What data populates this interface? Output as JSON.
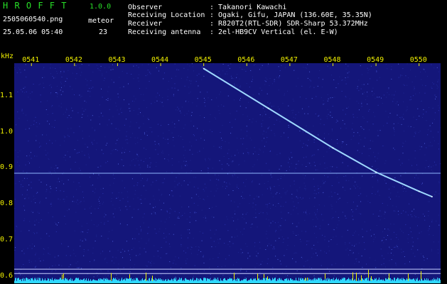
{
  "app": {
    "name": "H R O F F T",
    "version": "1.0.0",
    "filename": "2505060540.png",
    "datetime": "25.05.06 05:40",
    "meteor_label": "meteor",
    "meteor_count": "23"
  },
  "info": {
    "rows": [
      {
        "label": "Observer",
        "value": ": Takanori Kawachi"
      },
      {
        "label": "Receiving Location",
        "value": ": Ogaki, Gifu, JAPAN (136.60E, 35.35N)"
      },
      {
        "label": "Receiver",
        "value": ": R820T2(RTL-SDR) SDR-Sharp 53.372MHz"
      },
      {
        "label": "Receiving antenna",
        "value": ": 2el-HB9CV Vertical (el. E-W)"
      }
    ]
  },
  "colors": {
    "background": "#000000",
    "plot_bg": "#14167a",
    "label_yellow": "#f0f000",
    "title_green": "#28e028",
    "trace": "#9fd8ff",
    "baseline": "#30d8ff"
  },
  "chart_data": {
    "type": "scatter",
    "xlabel": "",
    "ylabel": "kHz",
    "x_ticks": [
      "0541",
      "0542",
      "0543",
      "0544",
      "0545",
      "0546",
      "0547",
      "0548",
      "0549",
      "0550"
    ],
    "y_ticks": [
      "1.1",
      "1.0",
      "0.9",
      "0.8",
      "0.7",
      "0.6"
    ],
    "ylim": [
      0.58,
      1.19
    ],
    "xlim_minutes": [
      40.6,
      50.5
    ],
    "horizontal_lines_khz": [
      0.885,
      0.619,
      0.607
    ],
    "trace": [
      {
        "x_min": 45.0,
        "y_khz": 1.175
      },
      {
        "x_min": 46.5,
        "y_khz": 1.065
      },
      {
        "x_min": 48.0,
        "y_khz": 0.955
      },
      {
        "x_min": 49.0,
        "y_khz": 0.888
      },
      {
        "x_min": 50.0,
        "y_khz": 0.835
      },
      {
        "x_min": 50.3,
        "y_khz": 0.82
      }
    ],
    "grid": false
  }
}
